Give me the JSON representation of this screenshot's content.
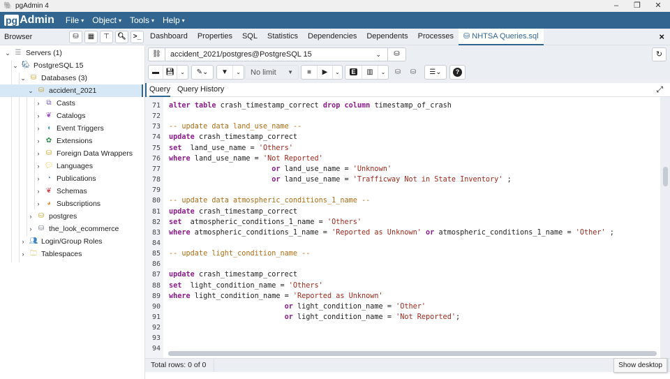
{
  "window": {
    "title": "pgAdmin 4",
    "controls": [
      "minimize",
      "restore",
      "close"
    ]
  },
  "menubar": {
    "logo_pg": "pg",
    "logo_rest": "Admin",
    "items": [
      {
        "label": "File"
      },
      {
        "label": "Object"
      },
      {
        "label": "Tools"
      },
      {
        "label": "Help"
      }
    ]
  },
  "browser": {
    "label": "Browser",
    "toolbar_icons": [
      "query-tool-icon",
      "view-data-icon",
      "filtered-rows-icon",
      "search-objects-icon",
      "psql-tool-icon"
    ],
    "tree": [
      {
        "label": "Servers (1)",
        "level": 0,
        "expanded": true,
        "icon": "servers-icon"
      },
      {
        "label": "PostgreSQL 15",
        "level": 1,
        "expanded": true,
        "icon": "elephant-icon"
      },
      {
        "label": "Databases (3)",
        "level": 2,
        "expanded": true,
        "icon": "databases-icon"
      },
      {
        "label": "accident_2021",
        "level": 3,
        "expanded": true,
        "icon": "database-icon",
        "selected": true
      },
      {
        "label": "Casts",
        "level": 4,
        "expanded": false,
        "icon": "casts-icon"
      },
      {
        "label": "Catalogs",
        "level": 4,
        "expanded": false,
        "icon": "catalogs-icon"
      },
      {
        "label": "Event Triggers",
        "level": 4,
        "expanded": false,
        "icon": "event-triggers-icon"
      },
      {
        "label": "Extensions",
        "level": 4,
        "expanded": false,
        "icon": "extensions-icon"
      },
      {
        "label": "Foreign Data Wrappers",
        "level": 4,
        "expanded": false,
        "icon": "fdw-icon"
      },
      {
        "label": "Languages",
        "level": 4,
        "expanded": false,
        "icon": "languages-icon"
      },
      {
        "label": "Publications",
        "level": 4,
        "expanded": false,
        "icon": "publications-icon"
      },
      {
        "label": "Schemas",
        "level": 4,
        "expanded": false,
        "icon": "schemas-icon"
      },
      {
        "label": "Subscriptions",
        "level": 4,
        "expanded": false,
        "icon": "subscriptions-icon"
      },
      {
        "label": "postgres",
        "level": 3,
        "expanded": false,
        "icon": "database-icon"
      },
      {
        "label": "the_look_ecommerce",
        "level": 3,
        "expanded": false,
        "icon": "database-disconnected-icon"
      },
      {
        "label": "Login/Group Roles",
        "level": 2,
        "expanded": false,
        "icon": "roles-icon"
      },
      {
        "label": "Tablespaces",
        "level": 2,
        "expanded": false,
        "icon": "tablespaces-icon"
      }
    ]
  },
  "tabs": {
    "items": [
      {
        "label": "Dashboard"
      },
      {
        "label": "Properties"
      },
      {
        "label": "SQL"
      },
      {
        "label": "Statistics"
      },
      {
        "label": "Dependencies"
      },
      {
        "label": "Dependents"
      },
      {
        "label": "Processes"
      },
      {
        "label": "NHTSA Queries.sql",
        "active": true
      }
    ],
    "close_label": "×"
  },
  "query_tool": {
    "connection": "accident_2021/postgres@PostgreSQL 15",
    "limit": "No limit",
    "sub_tabs": [
      {
        "label": "Query",
        "active": true
      },
      {
        "label": "Query History"
      }
    ]
  },
  "editor": {
    "lines": [
      {
        "n": "71",
        "tokens": [
          [
            "kw",
            "alter"
          ],
          [
            "t",
            " "
          ],
          [
            "kw",
            "table"
          ],
          [
            "t",
            " crash_timestamp_correct "
          ],
          [
            "kw",
            "drop"
          ],
          [
            "t",
            " "
          ],
          [
            "kw",
            "column"
          ],
          [
            "t",
            " timestamp_of_crash"
          ]
        ]
      },
      {
        "n": "72",
        "tokens": []
      },
      {
        "n": "73",
        "tokens": [
          [
            "cm",
            "-- update data land_use_name --"
          ]
        ]
      },
      {
        "n": "74",
        "tokens": [
          [
            "kw",
            "update"
          ],
          [
            "t",
            " crash_timestamp_correct"
          ]
        ]
      },
      {
        "n": "75",
        "tokens": [
          [
            "kw",
            "set"
          ],
          [
            "t",
            "  land_use_name = "
          ],
          [
            "str",
            "'Others'"
          ]
        ]
      },
      {
        "n": "76",
        "tokens": [
          [
            "kw",
            "where"
          ],
          [
            "t",
            " land_use_name = "
          ],
          [
            "str",
            "'Not Reported'"
          ]
        ]
      },
      {
        "n": "77",
        "tokens": [
          [
            "t",
            "                        "
          ],
          [
            "kw",
            "or"
          ],
          [
            "t",
            " land_use_name = "
          ],
          [
            "str",
            "'Unknown'"
          ]
        ]
      },
      {
        "n": "78",
        "tokens": [
          [
            "t",
            "                        "
          ],
          [
            "kw",
            "or"
          ],
          [
            "t",
            " land_use_name = "
          ],
          [
            "str",
            "'Trafficway Not in State Inventory'"
          ],
          [
            "t",
            " ;"
          ]
        ]
      },
      {
        "n": "79",
        "tokens": []
      },
      {
        "n": "80",
        "tokens": [
          [
            "cm",
            "-- update data atmospheric_conditions_1_name --"
          ]
        ]
      },
      {
        "n": "81",
        "tokens": [
          [
            "kw",
            "update"
          ],
          [
            "t",
            " crash_timestamp_correct"
          ]
        ]
      },
      {
        "n": "82",
        "tokens": [
          [
            "kw",
            "set"
          ],
          [
            "t",
            "  atmospheric_conditions_1_name = "
          ],
          [
            "str",
            "'Others'"
          ]
        ]
      },
      {
        "n": "83",
        "tokens": [
          [
            "kw",
            "where"
          ],
          [
            "t",
            " atmospheric_conditions_1_name = "
          ],
          [
            "str",
            "'Reported as Unknown'"
          ],
          [
            "t",
            " "
          ],
          [
            "kw",
            "or"
          ],
          [
            "t",
            " atmospheric_conditions_1_name = "
          ],
          [
            "str",
            "'Other'"
          ],
          [
            "t",
            " ;"
          ]
        ]
      },
      {
        "n": "84",
        "tokens": []
      },
      {
        "n": "85",
        "tokens": [
          [
            "cm",
            "-- update light_condition_name --"
          ]
        ]
      },
      {
        "n": "86",
        "tokens": []
      },
      {
        "n": "87",
        "tokens": [
          [
            "kw",
            "update"
          ],
          [
            "t",
            " crash_timestamp_correct"
          ]
        ]
      },
      {
        "n": "88",
        "tokens": [
          [
            "kw",
            "set"
          ],
          [
            "t",
            "  light_condition_name = "
          ],
          [
            "str",
            "'Others'"
          ]
        ]
      },
      {
        "n": "89",
        "tokens": [
          [
            "kw",
            "where"
          ],
          [
            "t",
            " light_condition_name = "
          ],
          [
            "str",
            "'Reported as Unknown'"
          ]
        ]
      },
      {
        "n": "90",
        "tokens": [
          [
            "t",
            "                           "
          ],
          [
            "kw",
            "or"
          ],
          [
            "t",
            " light_condition_name = "
          ],
          [
            "str",
            "'Other'"
          ]
        ]
      },
      {
        "n": "91",
        "tokens": [
          [
            "t",
            "                           "
          ],
          [
            "kw",
            "or"
          ],
          [
            "t",
            " light_condition_name = "
          ],
          [
            "str",
            "'Not Reported'"
          ],
          [
            "t",
            ";"
          ]
        ]
      },
      {
        "n": "92",
        "tokens": []
      },
      {
        "n": "93",
        "tokens": []
      },
      {
        "n": "94",
        "tokens": []
      }
    ]
  },
  "status": {
    "total_rows": "Total rows: 0 of 0"
  },
  "tooltip": {
    "text": "Show desktop"
  },
  "colors": {
    "brand": "#326690",
    "keyword": "#8b1b8b",
    "string": "#a1281c",
    "comment": "#b06c12"
  }
}
